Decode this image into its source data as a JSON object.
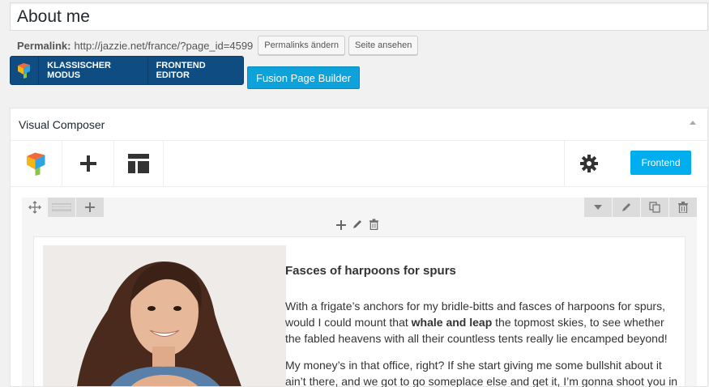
{
  "title": {
    "value": "About me"
  },
  "permalink": {
    "label": "Permalink:",
    "url": "http://jazzie.net/france/?page_id=4599",
    "change_button": "Permalinks ändern",
    "view_button": "Seite ansehen"
  },
  "vc_switch": {
    "classic_mode": "KLASSISCHER MODUS",
    "frontend_editor": "FRONTEND EDITOR"
  },
  "fusion_button": "Fusion Page Builder",
  "panel": {
    "title": "Visual Composer",
    "frontend_button": "Frontend"
  },
  "content": {
    "heading": "Fasces of harpoons for spurs",
    "para1_before": "With a frigate’s anchors for my bridle-bitts and fasces of harpoons for spurs,",
    "para1_line2_start": "would I could mount that ",
    "para1_bold": "whale and leap",
    "para1_line2_end": " the topmost skies, to see whether",
    "para1_line3": "the fabled heavens with all their countless tents really lie encamped beyond!",
    "para2_line1": "My money’s in that office, right? If she start giving me some bullshit about it",
    "para2_line2": "ain’t there, and we got to go someplace else and get it, I’m gonna shoot you in"
  },
  "colors": {
    "vc_blue": "#0f4c81",
    "fusion_blue": "#0da3da",
    "frontend_blue": "#00aeef"
  }
}
